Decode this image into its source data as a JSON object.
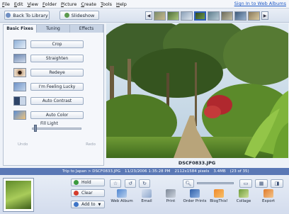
{
  "menu": [
    "File",
    "Edit",
    "View",
    "Folder",
    "Picture",
    "Create",
    "Tools",
    "Help"
  ],
  "signin": "Sign In to Web Albums",
  "topbar": {
    "back_label": "Back To Library",
    "slideshow_label": "Slideshow"
  },
  "left_panel": {
    "tabs": [
      "Basic Fixes",
      "Tuning",
      "Effects"
    ],
    "fixes": [
      "Crop",
      "Straighten",
      "Redeye",
      "I'm Feeling Lucky",
      "Auto Contrast",
      "Auto Color"
    ],
    "fill_light_label": "Fill Light",
    "fill_light_value": 0.04,
    "undo_label": "Undo",
    "redo_label": "Redo"
  },
  "photo": {
    "filename": "DSCF0833.JPG"
  },
  "infobar": {
    "path": "Trip to Japan > DSCF0833.JPG",
    "date": "11/23/2006 1:35:28 PM",
    "dims": "2112x1584 pixels",
    "size": "3.4MB",
    "count": "(23 of 35)"
  },
  "tray": {
    "hold_label": "Hold",
    "clear_label": "Clear",
    "add_label": "Add to"
  },
  "actions": [
    "Web Album",
    "Email",
    "Print",
    "Order Prints",
    "BlogThis!",
    "Collage",
    "Export"
  ],
  "colors": {
    "accent": "#5a78b5",
    "panel": "#f5f7fb"
  }
}
